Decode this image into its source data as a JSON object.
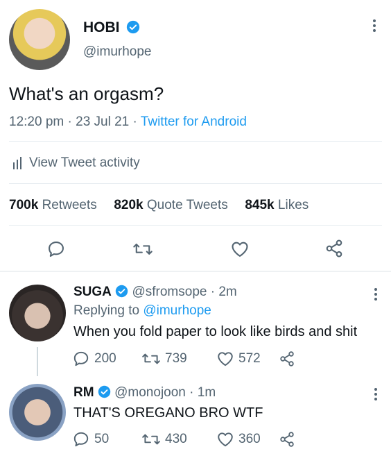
{
  "main_tweet": {
    "display_name": "HOBI",
    "handle": "@imurhope",
    "text": "What's an orgasm?",
    "time": "12:20 pm",
    "date": "23 Jul 21",
    "separator": "·",
    "source": "Twitter for Android",
    "activity_label": "View Tweet activity",
    "stats": {
      "retweets_count": "700k",
      "retweets_label": "Retweets",
      "quote_count": "820k",
      "quote_label": "Quote Tweets",
      "likes_count": "845k",
      "likes_label": "Likes"
    }
  },
  "replies": [
    {
      "display_name": "SUGA",
      "handle_time": "@sfromsope · 2m",
      "replying_prefix": "Replying to",
      "replying_to": "@imurhope",
      "text": "When you fold paper to look like birds and shit",
      "reply_count": "200",
      "retweet_count": "739",
      "like_count": "572"
    },
    {
      "display_name": "RM",
      "handle_time": "@monojoon · 1m",
      "text": "THAT'S OREGANO BRO WTF",
      "reply_count": "50",
      "retweet_count": "430",
      "like_count": "360"
    }
  ],
  "colors": {
    "accent": "#1d9bf0",
    "text": "#0f1419",
    "muted": "#536471",
    "divider": "#e6ecf0"
  }
}
